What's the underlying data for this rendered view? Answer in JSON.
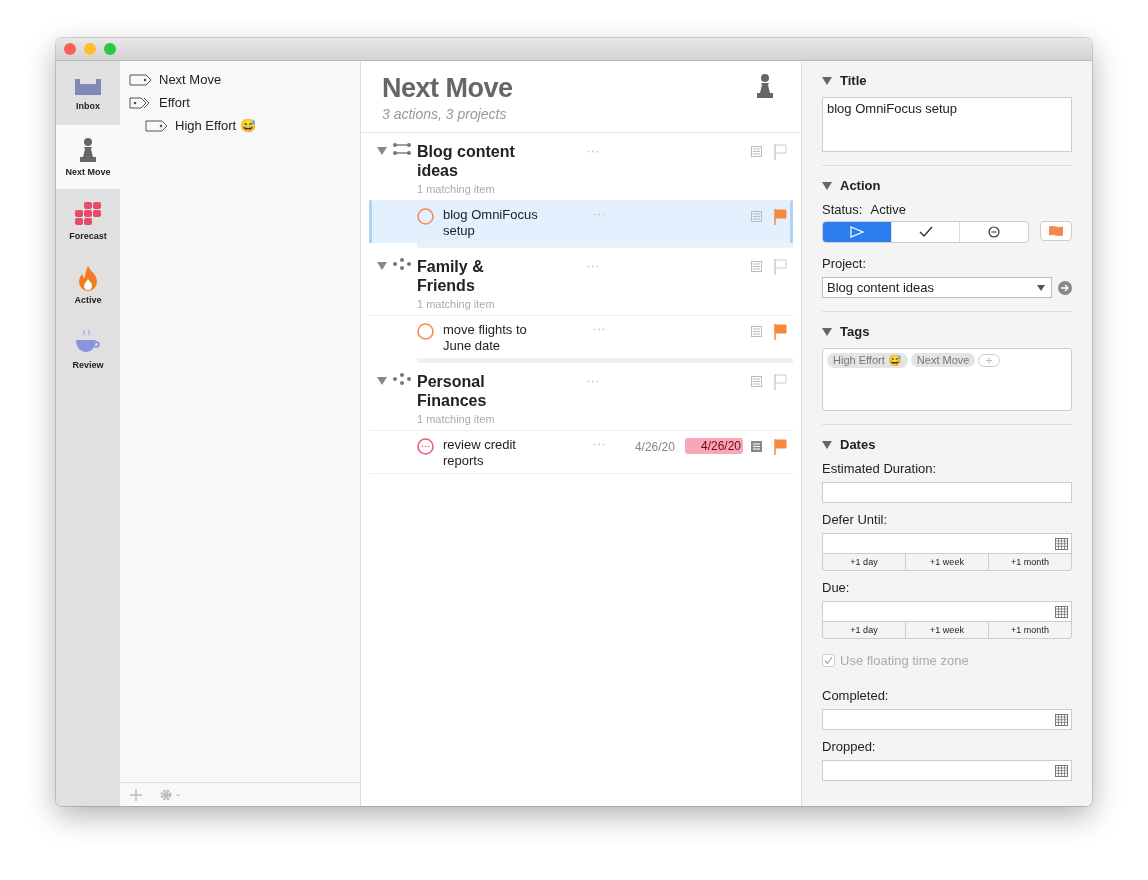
{
  "sidebar": {
    "items": [
      {
        "label": "Inbox",
        "kind": "inbox",
        "selected": false
      },
      {
        "label": "Next Move",
        "kind": "pawn",
        "selected": true
      },
      {
        "label": "Forecast",
        "kind": "forecast",
        "selected": false
      },
      {
        "label": "Active",
        "kind": "flame",
        "selected": false
      },
      {
        "label": "Review",
        "kind": "cup",
        "selected": false
      }
    ]
  },
  "tags": [
    {
      "label": "Next Move",
      "kind": "tag"
    },
    {
      "label": "Effort",
      "kind": "group",
      "children": [
        {
          "label": "High Effort 😅",
          "kind": "tag"
        }
      ]
    }
  ],
  "main": {
    "title": "Next Move",
    "subtitle": "3 actions, 3 projects",
    "projects": [
      {
        "name": "Blog content ideas",
        "kind": "sequential",
        "expanded": true,
        "count": "1 matching item",
        "flagged": false,
        "actions": [
          {
            "title": "blog OmniFocus setup",
            "selected": true,
            "overdue": false,
            "flagged": true,
            "has_note": false
          }
        ]
      },
      {
        "name": "Family & Friends",
        "kind": "parallel",
        "expanded": true,
        "count": "1 matching item",
        "flagged": false,
        "actions": [
          {
            "title": "move flights to June date",
            "selected": false,
            "overdue": false,
            "flagged": true,
            "has_note": false
          }
        ]
      },
      {
        "name": "Personal Finances",
        "kind": "parallel",
        "expanded": true,
        "count": "1 matching item",
        "flagged": false,
        "actions": [
          {
            "title": "review credit reports",
            "selected": false,
            "overdue": true,
            "flagged": true,
            "has_note": true,
            "defer": "4/26/20",
            "due": "4/26/20"
          }
        ]
      }
    ]
  },
  "inspector": {
    "title_section": {
      "heading": "Title",
      "expanded": true,
      "value": "blog OmniFocus setup"
    },
    "action_section": {
      "heading": "Action",
      "expanded": true,
      "status_label": "Status:",
      "status_value": "Active",
      "status_buttons": [
        {
          "kind": "active",
          "selected": true
        },
        {
          "kind": "complete",
          "selected": false
        },
        {
          "kind": "dropped",
          "selected": false
        }
      ],
      "flagged": true,
      "project_label": "Project:",
      "project_value": "Blog content ideas"
    },
    "tags_section": {
      "heading": "Tags",
      "expanded": true,
      "tags": [
        "High Effort 😅",
        "Next Move"
      ]
    },
    "dates_section": {
      "heading": "Dates",
      "expanded": true,
      "fields": [
        {
          "kind": "text",
          "label": "Estimated Duration:"
        },
        {
          "kind": "date",
          "label": "Defer Until:",
          "quick": [
            "+1 day",
            "+1 week",
            "+1 month"
          ]
        },
        {
          "kind": "date",
          "label": "Due:",
          "quick": [
            "+1 day",
            "+1 week",
            "+1 month"
          ]
        },
        {
          "kind": "checkbox",
          "label": "Use floating time zone",
          "checked": true,
          "disabled": true
        },
        {
          "kind": "date",
          "label": "Completed:"
        },
        {
          "kind": "date",
          "label": "Dropped:"
        }
      ]
    }
  }
}
